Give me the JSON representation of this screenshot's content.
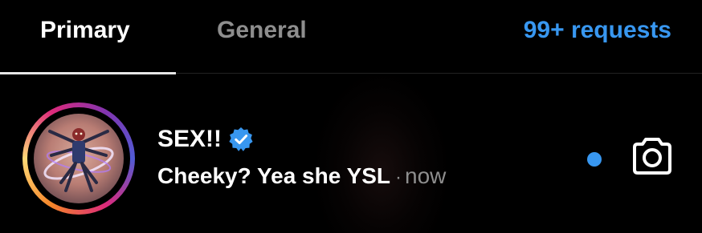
{
  "tabs": {
    "primary": "Primary",
    "general": "General",
    "requests": "99+ requests"
  },
  "conversation": {
    "name": "SEX!!",
    "verified": true,
    "message": "Cheeky? Yea she YSL",
    "separator": "·",
    "time": "now",
    "unread": true,
    "action_icon": "camera-icon"
  },
  "colors": {
    "background": "#000000",
    "accent": "#3897f0",
    "muted": "#8e8e8e"
  }
}
